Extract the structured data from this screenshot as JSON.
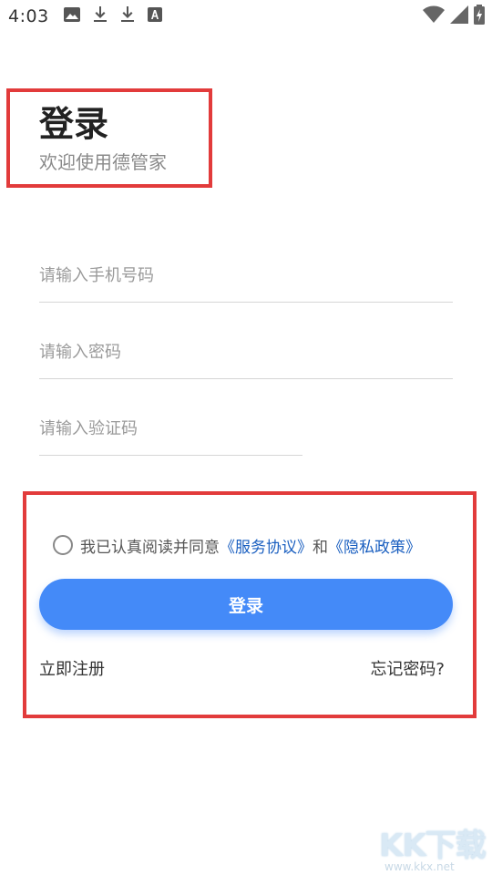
{
  "status_bar": {
    "time": "4:03",
    "left_icons": [
      "image-icon",
      "download-icon",
      "download-icon",
      "text-a-icon"
    ],
    "right_icons": [
      "wifi-icon",
      "signal-icon",
      "battery-charging-icon"
    ]
  },
  "header": {
    "title": "登录",
    "subtitle": "欢迎使用德管家"
  },
  "form": {
    "phone_placeholder": "请输入手机号码",
    "password_placeholder": "请输入密码",
    "code_placeholder": "请输入验证码"
  },
  "agreement": {
    "checked": false,
    "prefix": "我已认真阅读并同意",
    "service_link": "《服务协议》",
    "conjunction": "和",
    "privacy_link": "《隐私政策》"
  },
  "actions": {
    "login_label": "登录",
    "register_label": "立即注册",
    "forgot_label": "忘记密码?"
  },
  "watermark": {
    "brand": "KK下载",
    "url": "www.kkx.net"
  },
  "colors": {
    "accent": "#448af8",
    "link": "#1a5fc0",
    "highlight_border": "#e23b3b"
  }
}
